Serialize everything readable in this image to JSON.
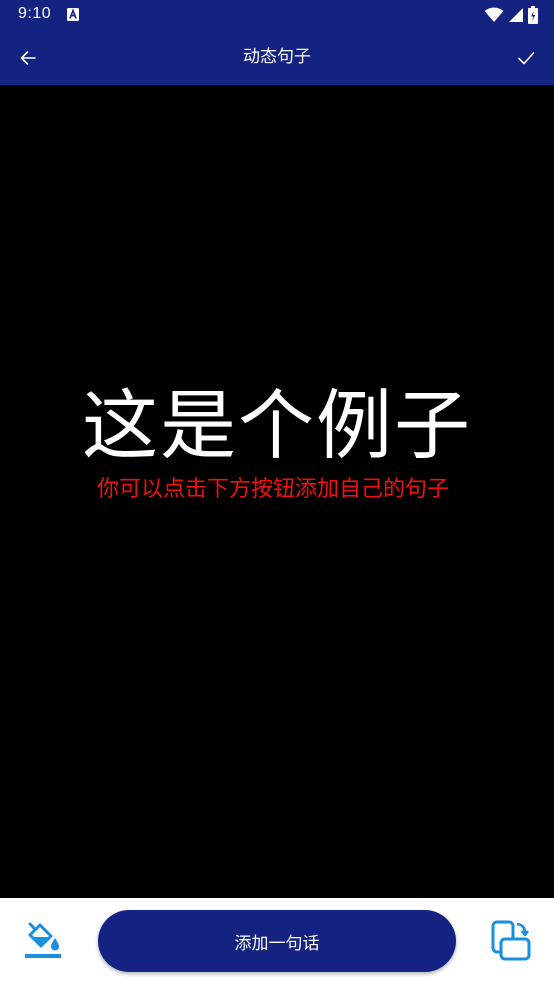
{
  "status_bar": {
    "time": "9:10",
    "icons": [
      "a-notification-icon",
      "wifi-icon",
      "signal-icon",
      "battery-icon"
    ]
  },
  "app_bar": {
    "title": "动态句子",
    "back_icon": "arrow-left-icon",
    "confirm_icon": "checkmark-icon",
    "background": "#142282"
  },
  "canvas": {
    "background": "#000000",
    "main_sentence": "这是个例子",
    "main_color": "#ffffff",
    "sub_sentence": "你可以点击下方按钮添加自己的句子",
    "sub_color": "#f01010"
  },
  "bottom_bar": {
    "left_icon": "paint-bucket-icon",
    "add_button_label": "添加一句话",
    "right_icon": "rotate-screen-icon",
    "accent_color": "#1a8fe0"
  }
}
